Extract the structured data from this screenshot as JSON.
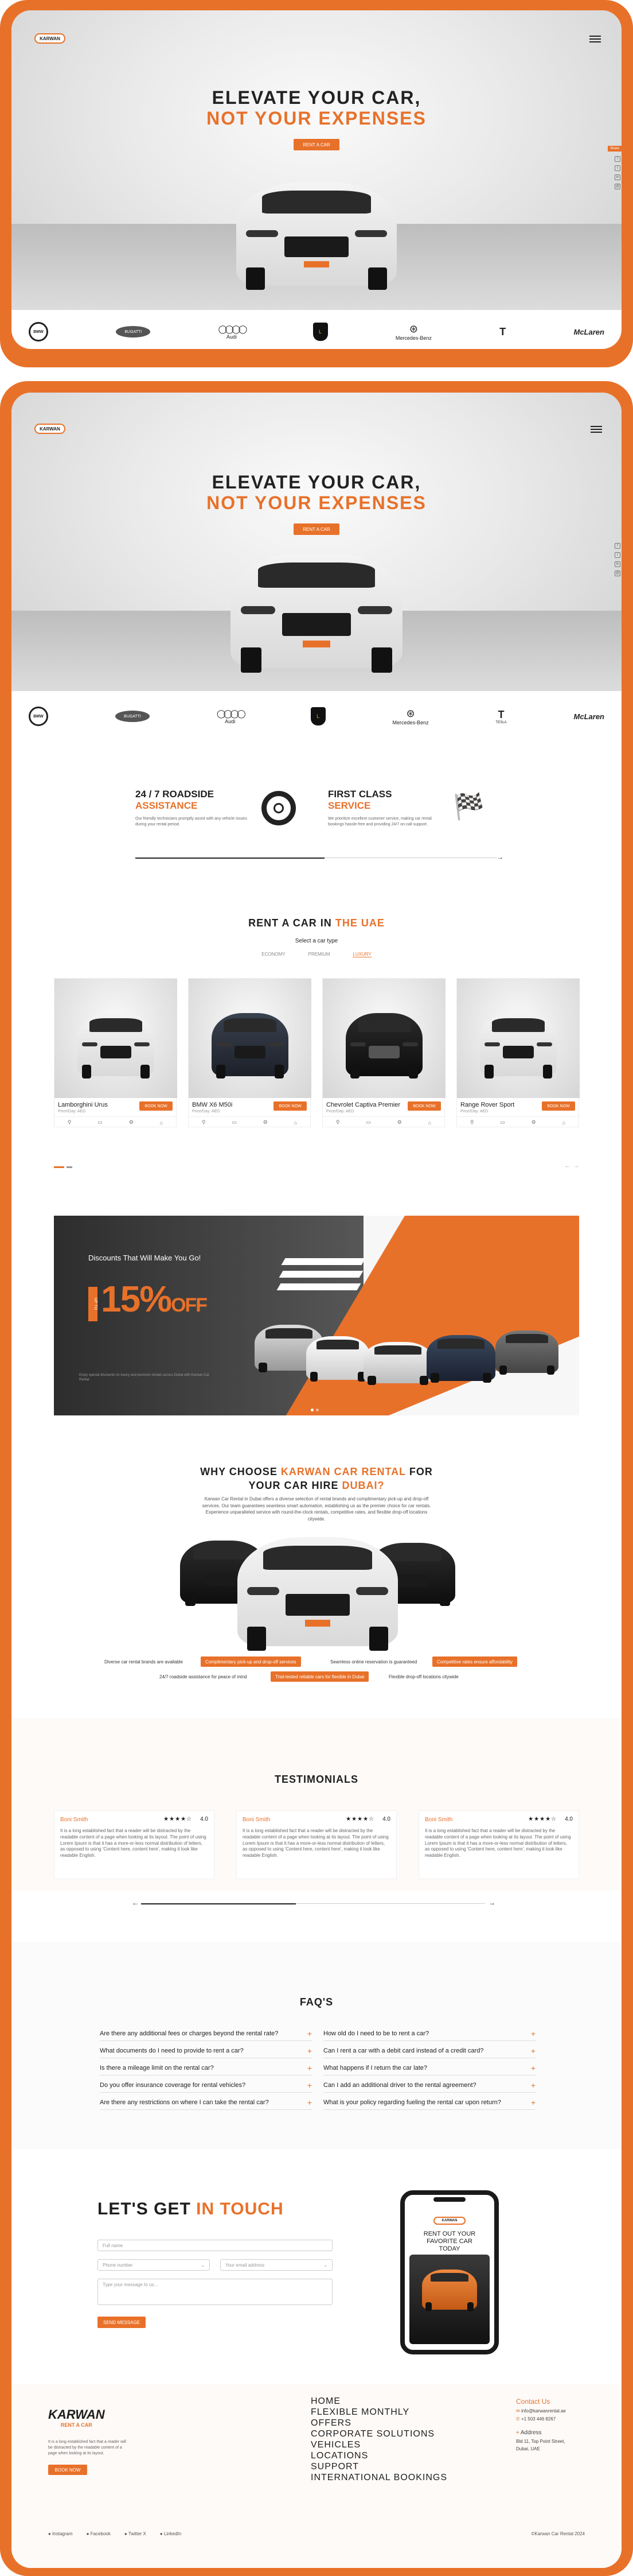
{
  "top_preview": {
    "logo_text": "KARWAN",
    "hero_line1": "ELEVATE YOUR CAR,",
    "hero_line2": "NOT YOUR EXPENSES",
    "cta": "RENT A CAR",
    "share_label": "Share",
    "brands": [
      {
        "name": "BMW",
        "mark": "BMW"
      },
      {
        "name": "BUGATTI",
        "mark": ""
      },
      {
        "name": "Audi",
        "mark": ""
      },
      {
        "name": "",
        "mark": "L"
      },
      {
        "name": "Mercedes-Benz",
        "mark": ""
      },
      {
        "name": "",
        "mark": "T"
      },
      {
        "name": "McLaren",
        "mark": ""
      }
    ]
  },
  "page": {
    "logo_text": "KARWAN",
    "hero_line1": "ELEVATE YOUR CAR,",
    "hero_line2": "NOT YOUR EXPENSES",
    "cta": "RENT A CAR",
    "brands": [
      {
        "name": "BMW",
        "mark": "BMW"
      },
      {
        "name": "BUGATTI",
        "mark": ""
      },
      {
        "name": "Audi",
        "mark": ""
      },
      {
        "name": "",
        "mark": "L"
      },
      {
        "name": "Mercedes-Benz",
        "mark": ""
      },
      {
        "name": "TESLA",
        "mark": "T"
      },
      {
        "name": "McLaren",
        "mark": ""
      }
    ],
    "features": [
      {
        "title_a": "24 / 7 ROADSIDE",
        "title_b": "ASSISTANCE",
        "text": "Our friendly technicians promptly assist with any vehicle issues during your rental period."
      },
      {
        "title_a": "FIRST CLASS",
        "title_b": "SERVICE",
        "text": "We prioritize excellent customer service, making car rental bookings hassle-free and providing 24/7 on-call support."
      }
    ],
    "rent_title_a": "RENT A CAR IN",
    "rent_title_b": "THE UAE",
    "select_label": "Select a car type",
    "car_types": [
      "ECONOMY",
      "PREMIUM",
      "LUXURY"
    ],
    "book_label": "BOOK NOW",
    "cars": [
      {
        "name": "Lamborghini Urus",
        "price": "Price/Day: AED"
      },
      {
        "name": "BMW X6 M50i",
        "price": "Price/Day: AED"
      },
      {
        "name": "Chevrolet Captiva Premier",
        "price": "Price/Day: AED"
      },
      {
        "name": "Range Rover Sport",
        "price": "Price/Day: AED"
      }
    ],
    "promo": {
      "tagline": "Discounts That Will Make You Go!",
      "upto": "UP TO",
      "percent": "15%",
      "off": "OFF",
      "fine_print": "Enjoy special discounts on luxury and premium rentals across Dubai with Karwan Car Rental."
    },
    "why": {
      "title_a": "WHY CHOOSE",
      "title_b": "KARWAN CAR RENTAL",
      "title_c": "FOR",
      "title_d": "YOUR CAR HIRE",
      "title_e": "DUBAI?",
      "text": "Karwan Car Rental in Dubai offers a diverse selection of rental brands and complimentary pick-up and drop-off services. Our team guarantees seamless smart automation, establishing us as the premier choice for car rentals. Experience unparalleled service with round-the-clock rentals, competitive rates, and flexible drop-off locations citywide.",
      "pills": [
        "Diverse car rental brands are available",
        "Complimentary pick-up and drop-off services",
        "Seamless online reservation is guaranteed",
        "Competitive rates ensure affordability",
        "24/7 roadside assistance for peace of mind",
        "Trial-tested reliable cars for flexible in Dubai",
        "Flexible drop-off locations citywide"
      ]
    },
    "testimonials_title": "TESTIMONIALS",
    "testimonials": [
      {
        "name": "Boni Smith",
        "stars": "★★★★☆",
        "rating": "4.0",
        "text": "It is a long established fact that a reader will be distracted by the readable content of a page when looking at its layout. The point of using Lorem Ipsum is that it has a more-or-less normal distribution of letters, as opposed to using 'Content here, content here', making it look like readable English."
      },
      {
        "name": "Boni Smith",
        "stars": "★★★★☆",
        "rating": "4.0",
        "text": "It is a long established fact that a reader will be distracted by the readable content of a page when looking at its layout. The point of using Lorem Ipsum is that it has a more-or-less normal distribution of letters, as opposed to using 'Content here, content here', making it look like readable English."
      },
      {
        "name": "Boni Smith",
        "stars": "★★★★☆",
        "rating": "4.0",
        "text": "It is a long established fact that a reader will be distracted by the readable content of a page when looking at its layout. The point of using Lorem Ipsum is that it has a more-or-less normal distribution of letters, as opposed to using 'Content here, content here', making it look like readable English."
      }
    ],
    "faq_title": "FAQ'S",
    "faqs": [
      "Are there any additional fees or charges beyond the rental rate?",
      "How old do I need to be to rent a car?",
      "What documents do I need to provide to rent a car?",
      "Can I rent a car with a debit card instead of a credit card?",
      "Is there a mileage limit on the rental car?",
      "What happens if I return the car late?",
      "Do you offer insurance coverage for rental vehicles?",
      "Can I add an additional driver to the rental agreement?",
      "Are there any restrictions on where I can take the rental car?",
      "What is your policy regarding fueling the rental car upon return?"
    ],
    "contact": {
      "title_a": "LET'S GET",
      "title_b": "IN TOUCH",
      "name_ph": "Full name",
      "phone_ph": "Phone number",
      "email_ph": "Your email address",
      "message_ph": "Type your message to us...",
      "send": "SEND MESSAGE",
      "phone_screen_text": "RENT OUT YOUR FAVORITE CAR TODAY"
    },
    "footer": {
      "logo_line1": "KARWAN",
      "logo_line2": "RENT A CAR",
      "about": "It is a long established fact that a reader will be distracted by the readable content of a page when looking at its layout.",
      "footer_btn": "BOOK NOW",
      "menu": [
        "HOME",
        "FLEXIBLE MONTHLY",
        "OFFERS",
        "CORPORATE SOLUTIONS",
        "VEHICLES",
        "LOCATIONS",
        "SUPPORT",
        "INTERNATIONAL BOOKINGS"
      ],
      "contact_title": "Contact Us",
      "email": "info@karwanrental.ae",
      "phone": "+1 503 446 8267",
      "address_title": "Address",
      "address": "Bld 11, Top Point Street, Dubai, UAE",
      "social": [
        "Instagram",
        "Facebook",
        "Twitter X",
        "LinkedIn"
      ],
      "copyright": "©Karwan Car Rental 2024"
    }
  },
  "colors": {
    "accent": "#e8712a",
    "dark": "#1e1e1e"
  }
}
